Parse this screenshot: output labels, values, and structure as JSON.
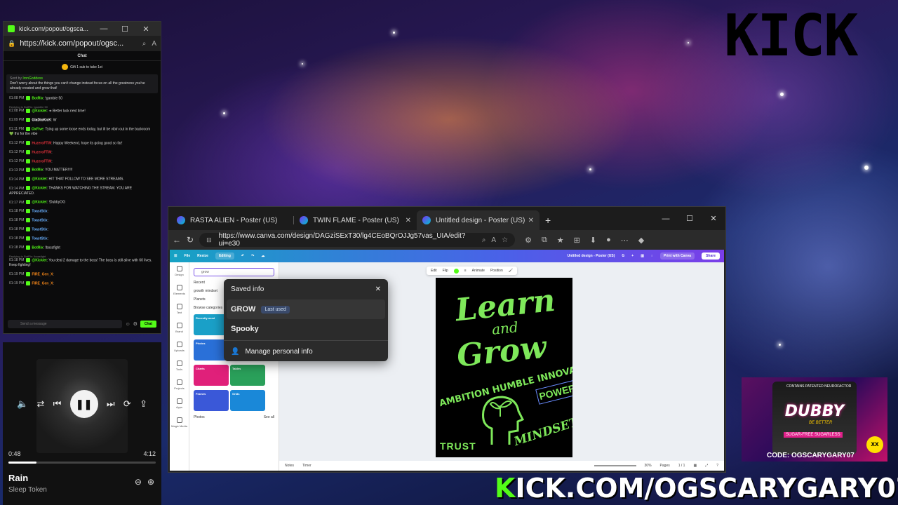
{
  "overlay": {
    "kick_logo": "KICK",
    "banner_k": "K",
    "banner_rest": "ICK.COM/OGSCARYGARY07"
  },
  "chat_window": {
    "title": "kick.com/popout/ogsca...",
    "url": "https://kick.com/popout/ogsc...",
    "header": "Chat",
    "gift_text": "Gift 1 sub to take 1st",
    "pinned_by": "Sent by",
    "pinned_user": "IronGoddess",
    "pinned_text": "Don't worry about the things you can't change instead focus on all the greatness you've already created and grow that!",
    "messages": [
      {
        "time": "01:08 PM",
        "user": "BotRix",
        "color": "#53fc18",
        "text": ": !gamble 50",
        "reply": ""
      },
      {
        "time": "01:08 PM",
        "user": "@Kicklet",
        "color": "#53fc18",
        "text": ": ➜ Better luck next time!",
        "reply": "Replying to BotRix: !gamble 50"
      },
      {
        "time": "01:09 PM",
        "user": "GlaDioKicK",
        "color": "#ffffff",
        "text": ": W",
        "reply": ""
      },
      {
        "time": "01:11 PM",
        "user": "OxFive",
        "color": "#53fc18",
        "text": ": Tying up some loose ends today, but ill be vibin out in the backroom 💚 thx for the vibe",
        "reply": ""
      },
      {
        "time": "01:12 PM",
        "user": "HuzeroFTW",
        "color": "#e0303a",
        "text": ": Happy Weekend, hope its going good so far!",
        "reply": ""
      },
      {
        "time": "01:12 PM",
        "user": "HuzeroFTW",
        "color": "#e0303a",
        "text": ":",
        "reply": ""
      },
      {
        "time": "01:12 PM",
        "user": "HuzeroFTW",
        "color": "#e0303a",
        "text": ":",
        "reply": ""
      },
      {
        "time": "01:13 PM",
        "user": "BotRix",
        "color": "#53fc18",
        "text": ": YOU MATTER!!!!!",
        "reply": ""
      },
      {
        "time": "01:14 PM",
        "user": "@Kicklet",
        "color": "#53fc18",
        "text": ": HIT THAT FOLLOW TO SEE MORE STREAMS.",
        "reply": ""
      },
      {
        "time": "01:14 PM",
        "user": "@Kicklet",
        "color": "#53fc18",
        "text": ": THANKS FOR WATCHING THE STREAM. YOU ARE APPRECIATED.",
        "reply": ""
      },
      {
        "time": "01:17 PM",
        "user": "@Kicklet",
        "color": "#53fc18",
        "text": ": !DubbyOG",
        "reply": ""
      },
      {
        "time": "01:18 PM",
        "user": "ToastStix",
        "color": "#6ab0ff",
        "text": ":",
        "reply": ""
      },
      {
        "time": "01:18 PM",
        "user": "ToastStix",
        "color": "#6ab0ff",
        "text": ":",
        "reply": ""
      },
      {
        "time": "01:18 PM",
        "user": "ToastStix",
        "color": "#6ab0ff",
        "text": ":",
        "reply": ""
      },
      {
        "time": "01:18 PM",
        "user": "ToastStix",
        "color": "#6ab0ff",
        "text": ":",
        "reply": ""
      },
      {
        "time": "01:18 PM",
        "user": "BotRix",
        "color": "#53fc18",
        "text": ": !bossfight",
        "reply": ""
      },
      {
        "time": "01:18 PM",
        "user": "@Kicklet",
        "color": "#53fc18",
        "text": ": You deal 2 damage to the boss! The boss is still alive with 60 lives. Keep fighting!",
        "reply": "Replying to BotRix: !bossfight"
      },
      {
        "time": "01:19 PM",
        "user": "FIRE_Gen_X",
        "color": "#ff8c1a",
        "text": ":",
        "reply": ""
      },
      {
        "time": "01:19 PM",
        "user": "FIRE_Gen_X",
        "color": "#ff8c1a",
        "text": ":",
        "reply": ""
      }
    ],
    "input_placeholder": "Send a message",
    "chat_button": "Chat"
  },
  "player": {
    "time_elapsed": "0:48",
    "time_total": "4:12",
    "progress": 0.19,
    "song": "Rain",
    "artist": "Sleep Token"
  },
  "browser": {
    "tabs": [
      {
        "label": "RASTA ALIEN - Poster (US)",
        "active": false
      },
      {
        "label": "TWIN FLAME - Poster (US)",
        "active": false
      },
      {
        "label": "Untitled design - Poster (US)",
        "active": true
      }
    ],
    "url": "https://www.canva.com/design/DAGziSExT30/lg4CEoBQrOJJg57vas_UIA/edit?ui=e30"
  },
  "canva": {
    "menu_file": "File",
    "menu_resize": "Resize",
    "menu_editing": "Editing",
    "doc_title": "Untitled design - Poster (US)",
    "print_button": "Print with Canva",
    "share_button": "Share",
    "rail": [
      "Design",
      "Elements",
      "Text",
      "Brand",
      "Uploads",
      "Tools",
      "Projects",
      "Apps",
      "Magic Media"
    ],
    "search_value": "grow",
    "recent_label": "Recent",
    "recent_item": "growth mindset",
    "planets_chip": "Planets",
    "browse_label": "Browse categories",
    "cards": [
      {
        "label": "Recently used",
        "color": "#1aa0c8"
      },
      {
        "label": "Graphics",
        "color": "#e83a6a"
      },
      {
        "label": "Photos",
        "color": "#2a70d8"
      },
      {
        "label": "Videos",
        "color": "#1a7ad8"
      },
      {
        "label": "Charts",
        "color": "#e0207a"
      },
      {
        "label": "Tables",
        "color": "#2aa05a"
      },
      {
        "label": "Frames",
        "color": "#3a58d8"
      },
      {
        "label": "Grids",
        "color": "#1a88d8"
      }
    ],
    "photos_label": "Photos",
    "see_all": "See all",
    "toolbar": {
      "edit": "Edit",
      "flip": "Flip",
      "animate": "Animate",
      "position": "Position"
    },
    "poster": {
      "learn": "Learn",
      "and": "and",
      "grow": "Grow",
      "ambition": "AMBITION HUMBLE INNOVATION",
      "power": "POWER",
      "trust": "TRUST",
      "mindset": "MINDSET"
    },
    "status": {
      "notes": "Notes",
      "timer": "Timer",
      "zoom": "30%",
      "pages": "Pages",
      "page_count": "1 / 1"
    }
  },
  "saved_info": {
    "title": "Saved info",
    "item1": "GROW",
    "item1_badge": "Last used",
    "item2": "Spooky",
    "manage": "Manage personal info"
  },
  "ad": {
    "top": "CONTAINS PATENTED NEUROFACTOR",
    "brand": "DUBBY",
    "tagline": "BE BETTER",
    "blend": "SUGAR-FREE SUGARLESS",
    "code": "CODE: OGSCARYGARY07",
    "smiley": "xx"
  }
}
